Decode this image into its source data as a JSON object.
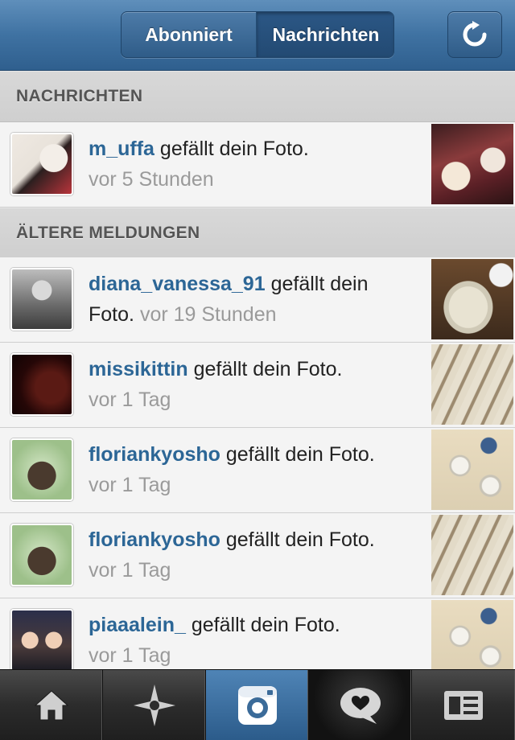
{
  "header": {
    "tabs": [
      {
        "label": "Abonniert",
        "selected": false
      },
      {
        "label": "Nachrichten",
        "selected": true
      }
    ],
    "refresh_icon": "refresh-icon"
  },
  "sections": [
    {
      "title": "NACHRICHTEN"
    },
    {
      "title": "ÄLTERE MELDUNGEN"
    }
  ],
  "notifications": [
    {
      "user": "m_uffa",
      "action": "gefällt dein Foto.",
      "time": "vor 5 Stunden"
    },
    {
      "user": "diana_vanessa_91",
      "action": "gefällt dein Foto.",
      "time": "vor 19 Stunden"
    },
    {
      "user": "missikittin",
      "action": "gefällt dein Foto.",
      "time": "vor 1 Tag"
    },
    {
      "user": "floriankyosho",
      "action": "gefällt dein Foto.",
      "time": "vor 1 Tag"
    },
    {
      "user": "floriankyosho",
      "action": "gefällt dein Foto.",
      "time": "vor 1 Tag"
    },
    {
      "user": "piaaalein_",
      "action": "gefällt dein Foto.",
      "time": "vor 1 Tag"
    }
  ],
  "tabbar": {
    "items": [
      "home-icon",
      "explore-icon",
      "camera-icon",
      "news-icon",
      "profile-icon"
    ],
    "active": "camera-icon"
  },
  "colors": {
    "username": "#2c6696",
    "header_blue": "#3f72a2",
    "timestamp": "#9a9a9a"
  }
}
